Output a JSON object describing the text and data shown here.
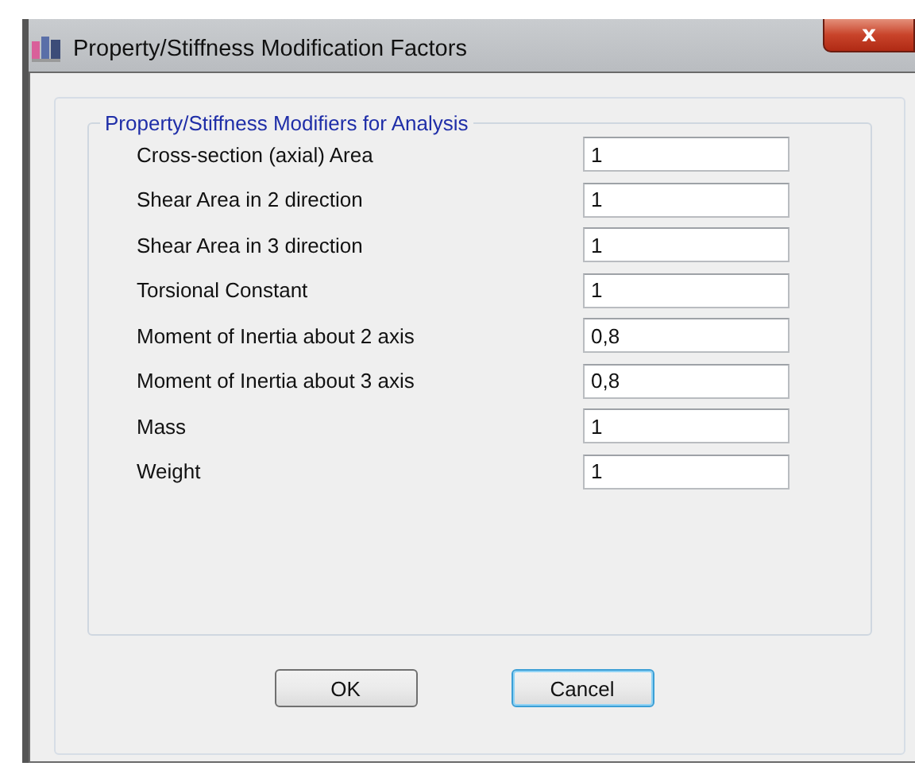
{
  "window": {
    "title": "Property/Stiffness Modification Factors",
    "close": "x"
  },
  "group": {
    "title": "Property/Stiffness Modifiers for Analysis",
    "fields": [
      {
        "label": "Cross-section (axial) Area",
        "value": "1"
      },
      {
        "label": "Shear Area in 2 direction",
        "value": "1"
      },
      {
        "label": "Shear Area in 3 direction",
        "value": "1"
      },
      {
        "label": "Torsional Constant",
        "value": "1"
      },
      {
        "label": "Moment of Inertia about 2 axis",
        "value": "0,8"
      },
      {
        "label": "Moment of Inertia about 3 axis",
        "value": "0,8"
      },
      {
        "label": "Mass",
        "value": "1"
      },
      {
        "label": "Weight",
        "value": "1"
      }
    ]
  },
  "buttons": [
    {
      "label": "OK",
      "focused": false
    },
    {
      "label": "Cancel",
      "focused": true
    }
  ]
}
